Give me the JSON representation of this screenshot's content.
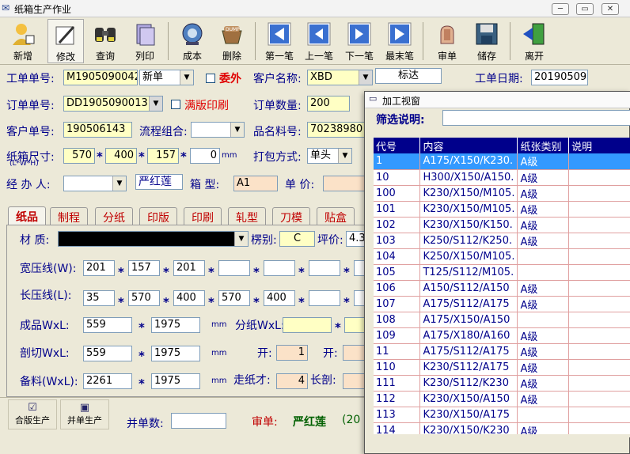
{
  "window": {
    "title": "纸箱生产作业",
    "min": "─",
    "max": "▭",
    "close": "✕"
  },
  "toolbar": [
    {
      "label": "新增",
      "icon": "add-person-icon"
    },
    {
      "label": "修改",
      "icon": "edit-icon"
    },
    {
      "label": "查询",
      "icon": "binoculars-icon"
    },
    {
      "label": "列印",
      "icon": "print-icon"
    },
    {
      "label": "成本",
      "icon": "cost-icon"
    },
    {
      "label": "删除",
      "icon": "dump-icon"
    },
    {
      "label": "第一笔",
      "icon": "first-icon"
    },
    {
      "label": "上一笔",
      "icon": "prev-icon"
    },
    {
      "label": "下一笔",
      "icon": "next-icon"
    },
    {
      "label": "最末笔",
      "icon": "last-icon"
    },
    {
      "label": "审单",
      "icon": "approve-icon"
    },
    {
      "label": "储存",
      "icon": "save-icon"
    },
    {
      "label": "离开",
      "icon": "exit-icon"
    }
  ],
  "header": {
    "work_no_label": "工单单号:",
    "work_no": "M1905090042",
    "work_type": "新单",
    "outsource_label": "委外",
    "customer_label": "客户名称:",
    "customer_code": "XBD",
    "customer_name": "标达",
    "work_date_label": "工单日期:",
    "work_date": "20190509",
    "order_no_label": "订单单号:",
    "order_no": "DD1905090013",
    "full_print_label": "满版印刷",
    "order_qty_label": "订单数量:",
    "order_qty": "200",
    "cust_no_label": "客户单号:",
    "cust_no": "190506143",
    "flow_label": "流程组合:",
    "flow": "",
    "part_label": "品名料号:",
    "part": "70238980",
    "size_label": "纸箱尺寸:",
    "size_sub": "(L*W*H)",
    "size_l": "570",
    "size_w": "400",
    "size_h": "157",
    "size_x": "0",
    "size_unit": "mm",
    "pack_label": "打包方式:",
    "pack": "单头",
    "handler_label": "经 办 人:",
    "handler": "",
    "handler_name": "严红莲",
    "box_type_label": "箱  型:",
    "box_type": "A1",
    "price_label": "单 价:",
    "price": ""
  },
  "tabs": [
    "纸品",
    "制程",
    "分纸",
    "印版",
    "印刷",
    "轧型",
    "刀模",
    "贴盒"
  ],
  "paper": {
    "material_label": "材 质:",
    "flute_label": "楞别:",
    "flute": "C",
    "grade_label": "坪价:",
    "grade": "4.3",
    "width_label": "宽压线(W):",
    "width_vals": [
      "201",
      "157",
      "201",
      "",
      "",
      "",
      ""
    ],
    "length_label": "长压线(L):",
    "length_vals": [
      "35",
      "570",
      "400",
      "570",
      "400",
      "",
      ""
    ],
    "product_label": "成品WxL:",
    "product_w": "559",
    "product_l": "1975",
    "mm": "mm",
    "split_label": "分纸WxL:",
    "split_w": "",
    "split_l": "",
    "cut_label": "剖切WxL:",
    "cut_w": "559",
    "cut_l": "1975",
    "open_label": "开:",
    "open1": "1",
    "open2_label": "开:",
    "open2": "",
    "stock_label": "备料(WxL):",
    "stock_w": "2261",
    "stock_l": "1975",
    "run_label": "走纸才:",
    "run": "4",
    "long_cut_label": "长剖:",
    "long_cut": ""
  },
  "bottom": {
    "merge_print": "合版生产",
    "merge_order": "并单生产",
    "merge_count_label": "并单数:",
    "merge_count": "",
    "audit_label": "审单:",
    "audit_name": "严红莲",
    "audit_extra": "(20"
  },
  "popup": {
    "title": "加工视窗",
    "filter_label": "筛选说明:",
    "filter": "",
    "columns": [
      "代号",
      "内容",
      "纸张类别",
      "说明"
    ],
    "rows": [
      [
        "1",
        "A175/X150/K230.",
        "A级",
        ""
      ],
      [
        "10",
        "H300/X150/A150.",
        "A级",
        ""
      ],
      [
        "100",
        "K230/X150/M105.",
        "A级",
        ""
      ],
      [
        "101",
        "K230/X150/M105.",
        "A级",
        ""
      ],
      [
        "102",
        "K230/X150/K150.",
        "A级",
        ""
      ],
      [
        "103",
        "K250/S112/K250.",
        "A级",
        ""
      ],
      [
        "104",
        "K250/X150/M105.",
        "",
        ""
      ],
      [
        "105",
        "T125/S112/M105.",
        "",
        ""
      ],
      [
        "106",
        "A150/S112/A150",
        "A级",
        ""
      ],
      [
        "107",
        "A175/S112/A175",
        "A级",
        ""
      ],
      [
        "108",
        "A175/X150/A150",
        "",
        ""
      ],
      [
        "109",
        "A175/X180/A160",
        "A级",
        ""
      ],
      [
        "11",
        "A175/S112/A175",
        "A级",
        ""
      ],
      [
        "110",
        "K230/S112/A175",
        "A级",
        ""
      ],
      [
        "111",
        "K230/S112/K230",
        "A级",
        ""
      ],
      [
        "112",
        "K230/X150/A150",
        "A级",
        ""
      ],
      [
        "113",
        "K230/X150/A175",
        "",
        ""
      ],
      [
        "114",
        "K230/X150/K230",
        "A级",
        ""
      ]
    ],
    "selected": 0
  }
}
